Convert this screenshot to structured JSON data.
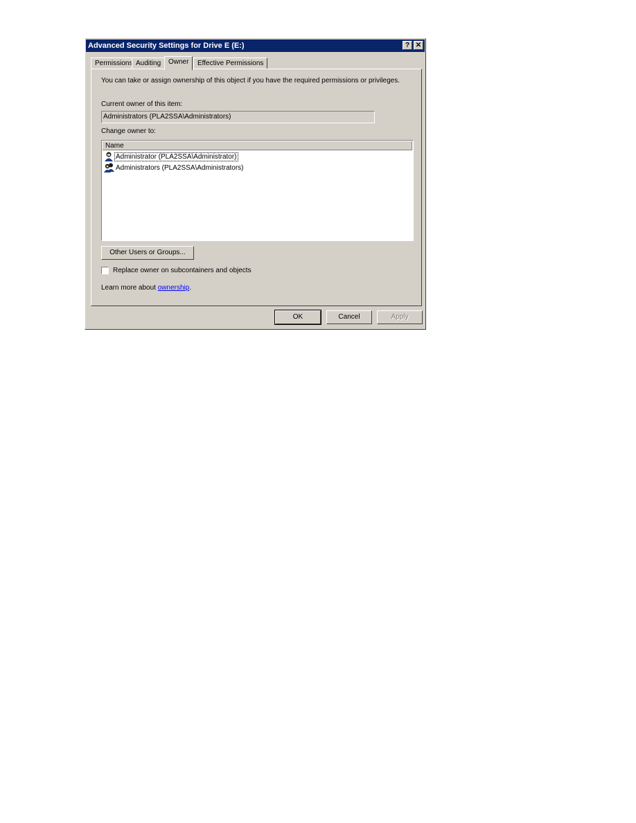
{
  "window": {
    "title": "Advanced Security Settings for Drive E (E:)",
    "help_button": "?",
    "close_button": "✕"
  },
  "tabs": [
    {
      "label": "Permissions",
      "active": false
    },
    {
      "label": "Auditing",
      "active": false
    },
    {
      "label": "Owner",
      "active": true
    },
    {
      "label": "Effective Permissions",
      "active": false
    }
  ],
  "owner": {
    "intro": "You can take or assign ownership of this object if you have the required permissions or privileges.",
    "current_owner_label": "Current owner of this item:",
    "current_owner_value": "Administrators (PLA2SSA\\Administrators)",
    "change_owner_label": "Change owner to:",
    "list_header": "Name",
    "list_items": [
      {
        "icon": "user-icon",
        "label": "Administrator (PLA2SSA\\Administrator)",
        "selected": true
      },
      {
        "icon": "group-icon",
        "label": "Administrators (PLA2SSA\\Administrators)",
        "selected": false
      }
    ],
    "other_users_button": "Other Users or Groups...",
    "replace_checkbox_label": "Replace owner on subcontainers and objects",
    "replace_checked": false,
    "learn_more_prefix": "Learn more about ",
    "learn_more_link": "ownership",
    "learn_more_suffix": "."
  },
  "buttons": {
    "ok": "OK",
    "cancel": "Cancel",
    "apply": "Apply"
  }
}
